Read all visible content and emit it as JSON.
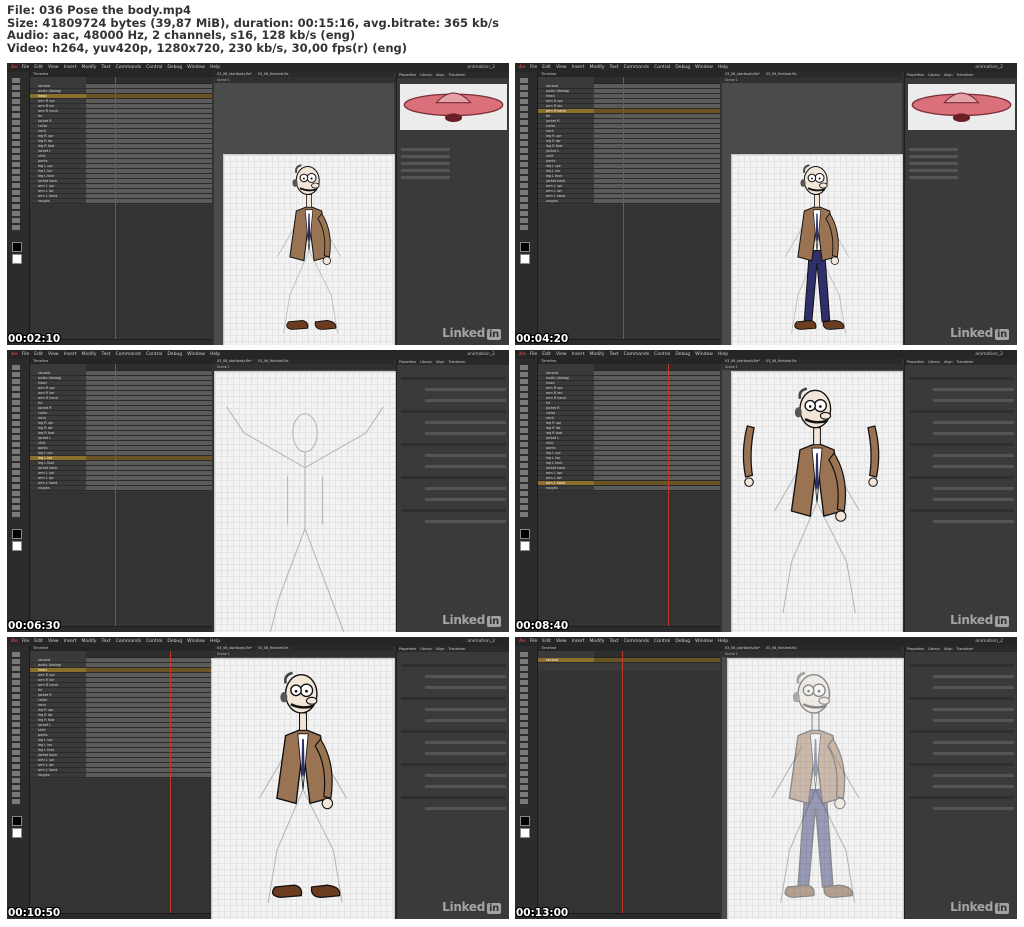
{
  "header": {
    "line1": "File: 036 Pose the body.mp4",
    "line2": "Size: 41809724 bytes (39,87 MiB), duration: 00:15:16, avg.bitrate: 365 kb/s",
    "line3": "Audio: aac, 48000 Hz, 2 channels, s16, 128 kb/s (eng)",
    "line4": "Video: h264, yuv420p, 1280x720, 230 kb/s, 30,00 fps(r) (eng)"
  },
  "app": {
    "menu": [
      "File",
      "Edit",
      "View",
      "Insert",
      "Modify",
      "Text",
      "Commands",
      "Control",
      "Debug",
      "Window",
      "Help"
    ],
    "workspace": "animation_2",
    "timeline_tab": "Timeline",
    "document_tab": "03_06_startbody.fla*",
    "document_tab2": "03_06_finished.fla",
    "scene": "Scene 1",
    "panel_tabs": [
      "Properties",
      "Library",
      "Align",
      "Transform"
    ],
    "watermark": "Linked",
    "watermark_in": "in"
  },
  "layers": [
    "second",
    "audio (dialog)",
    "head",
    "arm R upr",
    "arm R lwr",
    "arm R hand",
    "tie",
    "jacket R",
    "collar",
    "neck",
    "leg R upr",
    "leg R lwr",
    "leg R foot",
    "jacket L",
    "shirt",
    "pants",
    "leg L upr",
    "leg L lwr",
    "leg L foot",
    "jacket back",
    "arm L upr",
    "arm L lwr",
    "arm L hand",
    "roughs"
  ],
  "frames": [
    {
      "timestamp": "00:02:10",
      "selected_layer": 2
    },
    {
      "timestamp": "00:04:20",
      "selected_layer": 5
    },
    {
      "timestamp": "00:06:30",
      "selected_layer": 17
    },
    {
      "timestamp": "00:08:40",
      "selected_layer": 22
    },
    {
      "timestamp": "00:10:50",
      "selected_layer": 2
    },
    {
      "timestamp": "00:13:00",
      "selected_layer": 0
    }
  ],
  "colors": {
    "jacket": "#9a7352",
    "pants": "#2e2f6b",
    "shoes": "#6b3c1f",
    "skin": "#f2e6d8",
    "ufo": "#d9707a",
    "selected_layer": "#8b6f2a",
    "playhead": "#c0392b"
  }
}
